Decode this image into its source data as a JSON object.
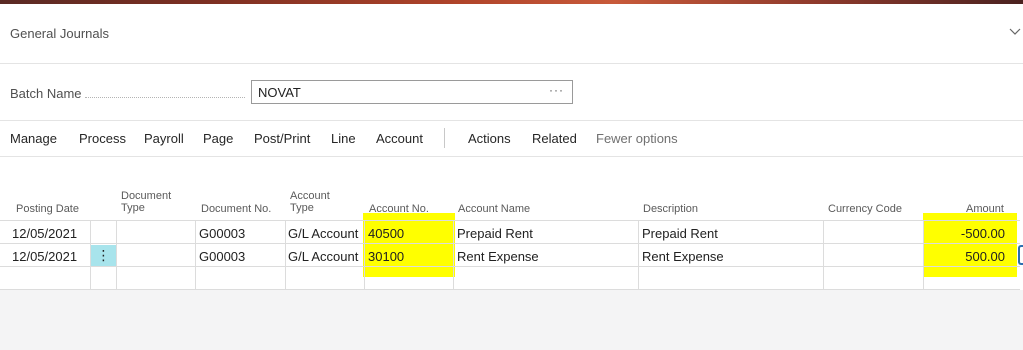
{
  "page": {
    "title": "General Journals"
  },
  "batch": {
    "label": "Batch Name",
    "value": "NOVAT",
    "lookup": "···"
  },
  "menu": {
    "items": [
      "Manage",
      "Process",
      "Payroll",
      "Page",
      "Post/Print",
      "Line",
      "Account",
      "Actions",
      "Related"
    ],
    "fewer_options": "Fewer options"
  },
  "grid": {
    "columns": {
      "posting_date": "Posting Date",
      "document_type": "Document Type",
      "document_no": "Document No.",
      "account_type": "Account Type",
      "account_no": "Account No.",
      "account_name": "Account Name",
      "description": "Description",
      "currency_code": "Currency Code",
      "amount": "Amount"
    },
    "rows": [
      {
        "posting_date": "12/05/2021",
        "document_type": "",
        "document_no": "G00003",
        "account_type": "G/L Account",
        "account_no": "40500",
        "account_name": "Prepaid Rent",
        "description": "Prepaid Rent",
        "currency_code": "",
        "amount": "-500.00"
      },
      {
        "posting_date": "12/05/2021",
        "document_type": "",
        "document_no": "G00003",
        "account_type": "G/L Account",
        "account_no": "30100",
        "account_name": "Rent Expense",
        "description": "Rent Expense",
        "currency_code": "",
        "amount": "500.00"
      }
    ],
    "row_action_icon": "⋮"
  },
  "colors": {
    "highlight": "#ffff00",
    "row_action_bg": "#a8e4ec",
    "accent": "#2a6fb0"
  }
}
